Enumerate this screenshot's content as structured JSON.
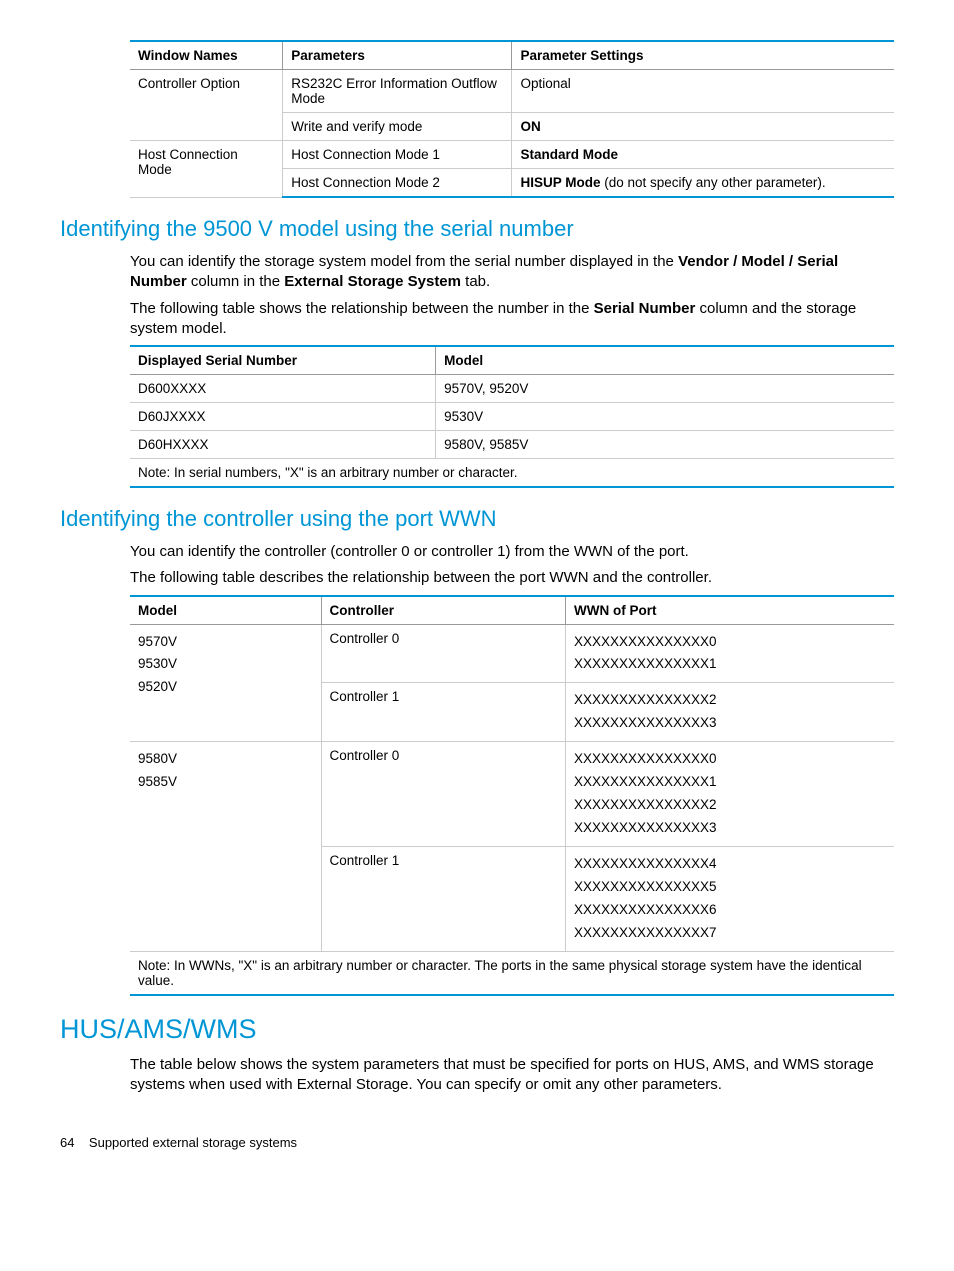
{
  "table1": {
    "headers": [
      "Window Names",
      "Parameters",
      "Parameter Settings"
    ],
    "r1c1": "Controller Option",
    "r1c2": "RS232C Error Information Outflow Mode",
    "r1c3": "Optional",
    "r2c2": "Write and verify mode",
    "r2c3": "ON",
    "r3c1": "Host Connection Mode",
    "r3c2": "Host Connection Mode 1",
    "r3c3": "Standard Mode",
    "r4c2": "Host Connection Mode 2",
    "r4c3a": "HISUP Mode",
    "r4c3b": " (do not specify any other parameter)."
  },
  "section1": {
    "heading": "Identifying the 9500 V model using the serial number",
    "p1a": "You can identify the storage system model from the serial number displayed in the ",
    "p1b": "Vendor / Model / Serial Number",
    "p1c": " column in the ",
    "p1d": "External Storage System",
    "p1e": " tab.",
    "p2a": "The following table shows the relationship between the number in the ",
    "p2b": "Serial Number",
    "p2c": " column and the storage system model."
  },
  "table2": {
    "headers": [
      "Displayed Serial Number",
      "Model"
    ],
    "r1": [
      "D600XXXX",
      "9570V, 9520V"
    ],
    "r2": [
      "D60JXXXX",
      "9530V"
    ],
    "r3": [
      "D60HXXXX",
      "9580V, 9585V"
    ],
    "note": "Note: In serial numbers, \"X\" is an arbitrary number or character."
  },
  "section2": {
    "heading": "Identifying the controller using the port WWN",
    "p1": "You can identify the controller (controller 0 or controller 1) from the WWN of the port.",
    "p2": "The following table describes the relationship between the port WWN and the controller."
  },
  "table3": {
    "headers": [
      "Model",
      "Controller",
      "WWN of Port"
    ],
    "m1l1": "9570V",
    "m1l2": "9530V",
    "m1l3": "9520V",
    "c0": "Controller 0",
    "c1": "Controller 1",
    "g1c0w1": "XXXXXXXXXXXXXXX0",
    "g1c0w2": "XXXXXXXXXXXXXXX1",
    "g1c1w1": "XXXXXXXXXXXXXXX2",
    "g1c1w2": "XXXXXXXXXXXXXXX3",
    "m2l1": "9580V",
    "m2l2": "9585V",
    "g2c0w1": "XXXXXXXXXXXXXXX0",
    "g2c0w2": "XXXXXXXXXXXXXXX1",
    "g2c0w3": "XXXXXXXXXXXXXXX2",
    "g2c0w4": "XXXXXXXXXXXXXXX3",
    "g2c1w1": "XXXXXXXXXXXXXXX4",
    "g2c1w2": "XXXXXXXXXXXXXXX5",
    "g2c1w3": "XXXXXXXXXXXXXXX6",
    "g2c1w4": "XXXXXXXXXXXXXXX7",
    "note": "Note: In WWNs, \"X\" is an arbitrary number or character. The ports in the same physical storage system have the identical value."
  },
  "section3": {
    "heading": "HUS/AMS/WMS",
    "p1": "The table below shows the system parameters that must be specified for ports on HUS, AMS, and WMS storage systems when used with External Storage. You can specify or omit any other parameters."
  },
  "footer": {
    "page": "64",
    "title": "Supported external storage systems"
  }
}
